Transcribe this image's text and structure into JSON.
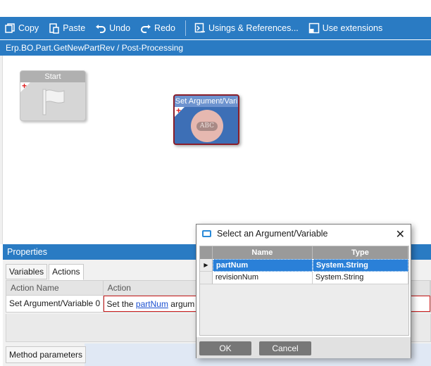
{
  "toolbar": {
    "copy_label": "Copy",
    "paste_label": "Paste",
    "undo_label": "Undo",
    "redo_label": "Redo",
    "usings_label": "Usings & References...",
    "extensions_label": "Use extensions"
  },
  "path": "Erp.BO.Part.GetNewPartRev / Post-Processing",
  "canvas": {
    "start_node_title": "Start",
    "set_node_title": "Set Argument/Vari",
    "abc_text": "ABC"
  },
  "properties": {
    "header": "Properties",
    "tabs": [
      "Variables",
      "Actions"
    ],
    "grid_headers": [
      "Action Name",
      "Action"
    ],
    "row": {
      "name": "Set Argument/Variable 0",
      "action_prefix": "Set the ",
      "action_link": "partNum",
      "action_suffix": " argum"
    },
    "bottom_tab": "Method parameters"
  },
  "dialog": {
    "title": "Select an Argument/Variable",
    "close_glyph": "✕",
    "columns": [
      "Name",
      "Type"
    ],
    "rows": [
      {
        "name": "partNum",
        "type": "System.String",
        "selected": true
      },
      {
        "name": "revisionNum",
        "type": "System.String",
        "selected": false
      }
    ],
    "ok_label": "OK",
    "cancel_label": "Cancel"
  },
  "colors": {
    "accent": "#2a7bc3",
    "selection": "#2a80d8",
    "node_set": "#3d6fb6",
    "node_border": "#8a1e2a"
  }
}
